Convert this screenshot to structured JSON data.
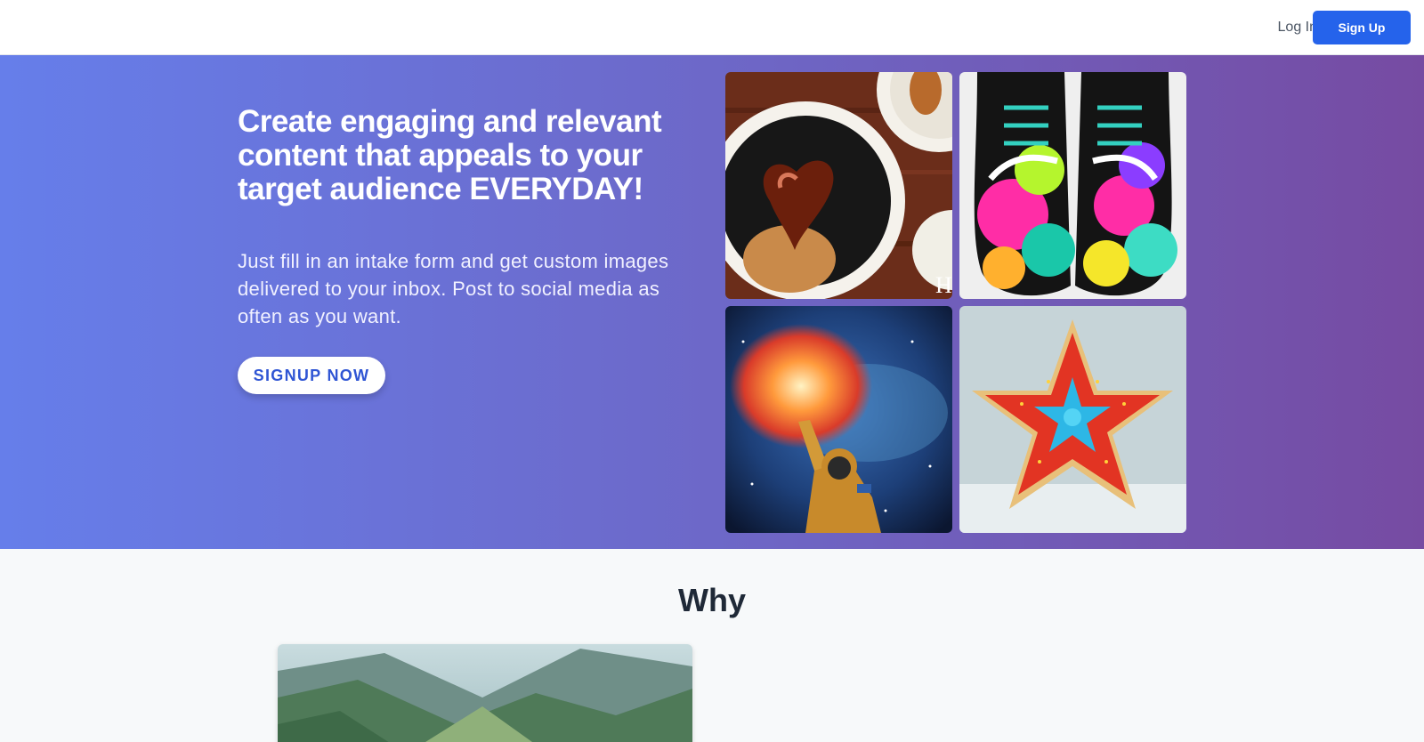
{
  "nav": {
    "login_label": "Log In",
    "signup_label": "Sign Up"
  },
  "hero": {
    "title": "Create engaging and relevant content that appeals to your target audience EVERYDAY!",
    "subtitle": "Just fill in an intake form and get custom images delivered to your inbox. Post to social media as often as you want.",
    "cta_label": "SIGNUP NOW",
    "gallery": [
      {
        "name": "chocolate-heart-pastry-image"
      },
      {
        "name": "floral-sneakers-image"
      },
      {
        "name": "astronaut-nebula-image"
      },
      {
        "name": "starfish-cookie-image"
      }
    ],
    "gallery_tile_letter": "H"
  },
  "why": {
    "title": "Why"
  },
  "colors": {
    "primary": "#2563eb",
    "hero_gradient_start": "#667eea",
    "hero_gradient_end": "#764ba2"
  }
}
